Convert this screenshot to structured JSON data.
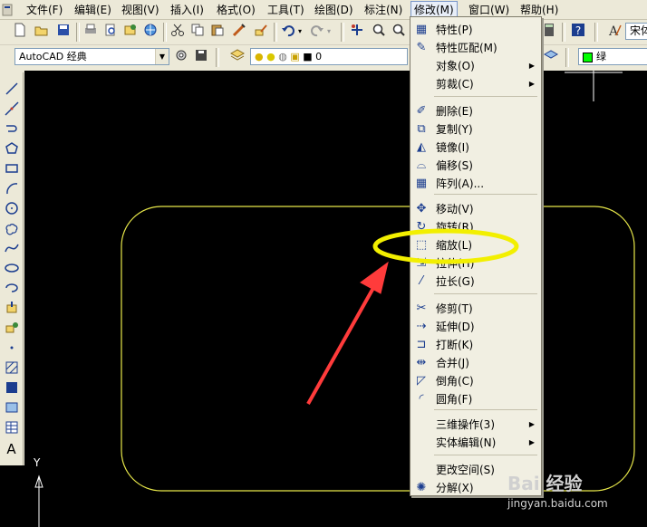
{
  "menubar": {
    "items": [
      {
        "label": "文件(F)"
      },
      {
        "label": "编辑(E)"
      },
      {
        "label": "视图(V)"
      },
      {
        "label": "插入(I)"
      },
      {
        "label": "格式(O)"
      },
      {
        "label": "工具(T)"
      },
      {
        "label": "绘图(D)"
      },
      {
        "label": "标注(N)"
      },
      {
        "label": "修改(M)"
      },
      {
        "label": "窗口(W)"
      },
      {
        "label": "帮助(H)"
      }
    ],
    "active_index": 8
  },
  "toolbar": {
    "workspace_combo_value": "AutoCAD 经典",
    "layer_combo_value": "0",
    "color_combo_value": "绿",
    "font_partial": "宋体"
  },
  "modify_menu": {
    "items": [
      {
        "label": "特性(P)",
        "icon": "properties-icon"
      },
      {
        "label": "特性匹配(M)",
        "icon": "match-properties-icon"
      },
      {
        "label": "对象(O)",
        "icon": "",
        "submenu": true
      },
      {
        "label": "剪裁(C)",
        "icon": "",
        "submenu": true
      },
      {
        "label": "删除(E)",
        "icon": "erase-icon"
      },
      {
        "label": "复制(Y)",
        "icon": "copy-icon"
      },
      {
        "label": "镜像(I)",
        "icon": "mirror-icon"
      },
      {
        "label": "偏移(S)",
        "icon": "offset-icon"
      },
      {
        "label": "阵列(A)...",
        "icon": "array-icon"
      },
      {
        "label": "移动(V)",
        "icon": "move-icon"
      },
      {
        "label": "旋转(R)",
        "icon": "rotate-icon"
      },
      {
        "label": "缩放(L)",
        "icon": "scale-icon"
      },
      {
        "label": "拉伸(H)",
        "icon": "stretch-icon"
      },
      {
        "label": "拉长(G)",
        "icon": "lengthen-icon"
      },
      {
        "label": "修剪(T)",
        "icon": "trim-icon"
      },
      {
        "label": "延伸(D)",
        "icon": "extend-icon"
      },
      {
        "label": "打断(K)",
        "icon": "break-icon"
      },
      {
        "label": "合并(J)",
        "icon": "join-icon"
      },
      {
        "label": "倒角(C)",
        "icon": "chamfer-icon"
      },
      {
        "label": "圆角(F)",
        "icon": "fillet-icon"
      },
      {
        "label": "三维操作(3)",
        "icon": "",
        "submenu": true
      },
      {
        "label": "实体编辑(N)",
        "icon": "",
        "submenu": true
      },
      {
        "label": "更改空间(S)",
        "icon": ""
      },
      {
        "label": "分解(X)",
        "icon": "explode-icon"
      }
    ]
  },
  "annotation": {
    "highlight_target": "缩放(L)",
    "highlight_color": "#f2ef00",
    "arrow_color": "#ff3b3b"
  },
  "drawing": {
    "shape_stroke_color": "#e8e84a",
    "background_color": "#000000",
    "ucs_label_y": "Y"
  },
  "watermark": {
    "brand": "Bai 经验",
    "url": "jingyan.baidu.com"
  }
}
